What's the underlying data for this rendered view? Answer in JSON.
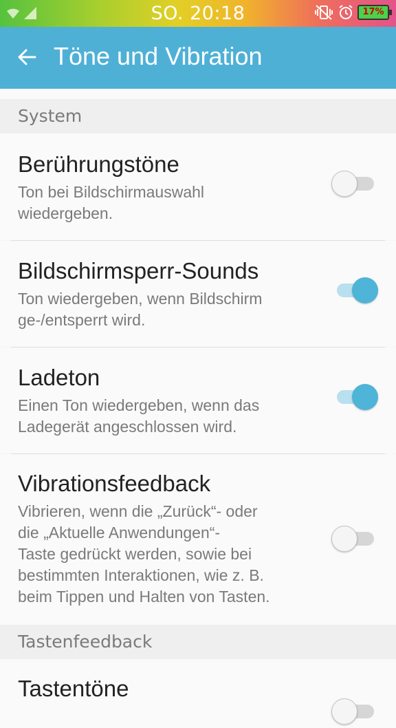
{
  "status_bar": {
    "time": "SO. 20:18",
    "battery": "17%",
    "icons": [
      "wifi-icon",
      "signal-icon",
      "mute-vibrate-icon",
      "alarm-icon",
      "battery-icon"
    ]
  },
  "app_bar": {
    "title": "Töne und Vibration",
    "back_icon": "back-arrow-icon"
  },
  "sections": {
    "system": "System",
    "tastenfeedback": "Tastenfeedback"
  },
  "items": [
    {
      "title": "Berührungstöne",
      "subtitle": [
        "Ton bei Bildschirmauswahl",
        "wiedergeben."
      ],
      "enabled": false
    },
    {
      "title": "Bildschirmsperr-Sounds",
      "subtitle": [
        "Ton wiedergeben, wenn Bildschirm",
        "ge-/entsperrt wird."
      ],
      "enabled": true
    },
    {
      "title": "Ladeton",
      "subtitle": [
        "Einen Ton wiedergeben, wenn das",
        "Ladegerät angeschlossen wird."
      ],
      "enabled": true
    },
    {
      "title": "Vibrationsfeedback",
      "subtitle": [
        "Vibrieren, wenn die „Zurück“- oder",
        "die „Aktuelle Anwendungen“-",
        "Taste gedrückt werden, sowie bei",
        "bestimmten Interaktionen, wie z. B.",
        "beim Tippen und Halten von Tasten."
      ],
      "enabled": false
    },
    {
      "title": "Tastentöne",
      "enabled": false
    }
  ],
  "colors": {
    "accent": "#4fb0d6",
    "switch_on": "#4eb4d8"
  }
}
